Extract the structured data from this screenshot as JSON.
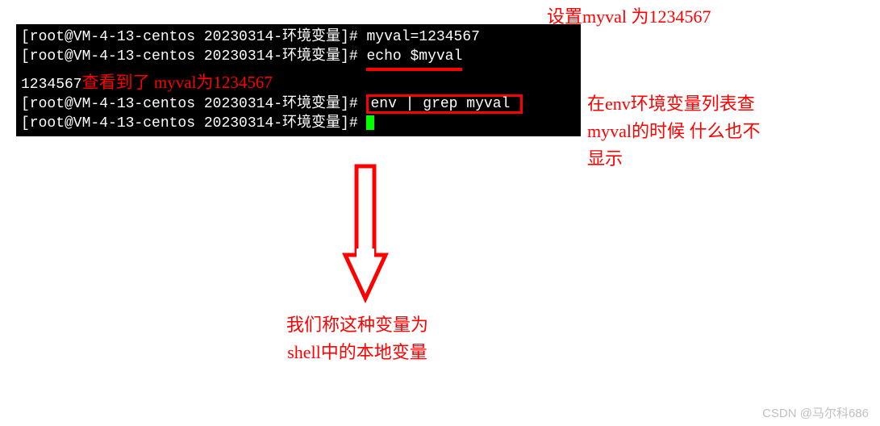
{
  "terminal": {
    "line1_prompt": "[root@VM-4-13-centos 20230314-环境变量]# ",
    "line1_cmd": "myval=1234567",
    "line2_prompt": "[root@VM-4-13-centos 20230314-环境变量]# ",
    "line2_cmd": "echo $myval",
    "line3_output": "1234567",
    "line3_note": "查看到了 myval为1234567",
    "line4_prompt": "[root@VM-4-13-centos 20230314-环境变量]# ",
    "line4_cmd": "env | grep myval ",
    "line5_prompt": "[root@VM-4-13-centos 20230314-环境变量]# "
  },
  "annotations": {
    "top": "设置myval 为1234567",
    "right_l1": "在env环境变量列表查",
    "right_l2": "myval的时候 什么也不",
    "right_l3": "显示",
    "bottom_l1": "我们称这种变量为",
    "bottom_l2": "shell中的本地变量"
  },
  "watermark": "CSDN @马尔科686",
  "colors": {
    "accent": "#ff0000",
    "terminal_bg": "#000000",
    "terminal_fg": "#ffffff",
    "cursor": "#00ff00"
  }
}
